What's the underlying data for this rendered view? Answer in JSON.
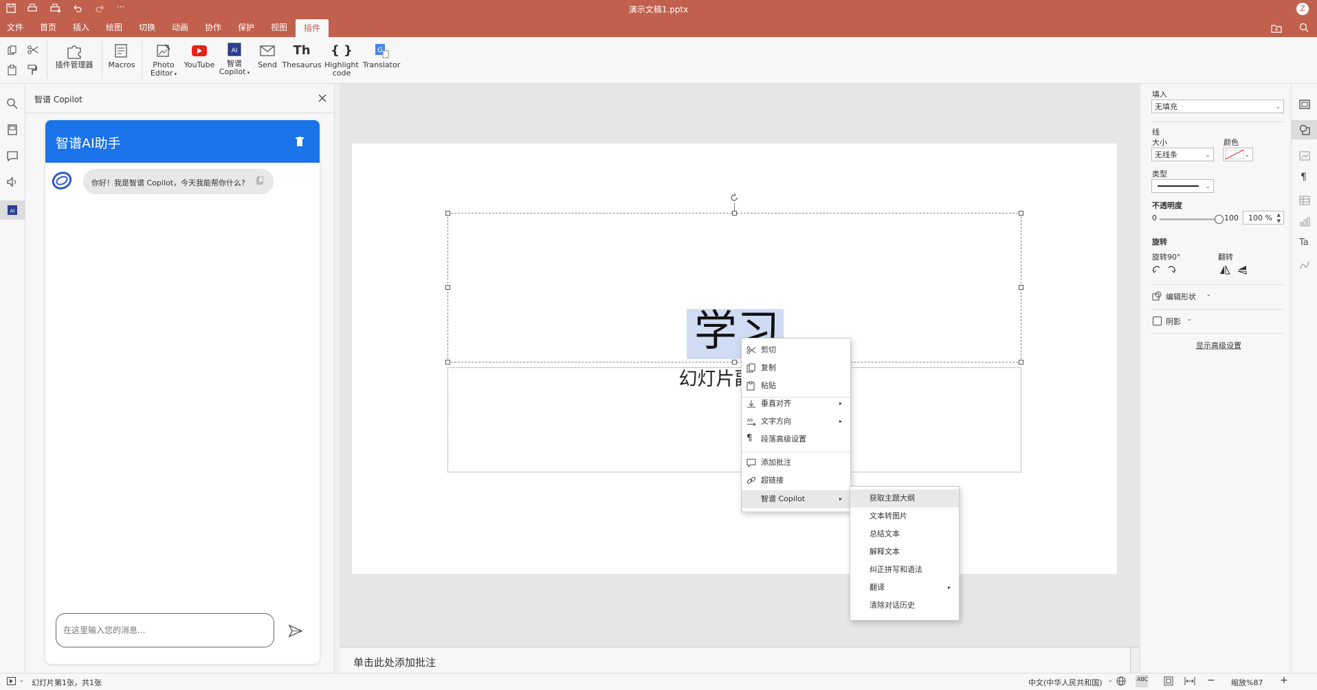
{
  "window": {
    "title": "演示文稿1.pptx",
    "user_initial": "Z"
  },
  "menu": {
    "items": [
      "文件",
      "首页",
      "插入",
      "绘图",
      "切换",
      "动画",
      "协作",
      "保护",
      "视图",
      "插件"
    ],
    "active": "插件"
  },
  "toolbar": {
    "plugin_manager": "插件管理器",
    "macros": "Macros",
    "photo_editor": [
      "Photo",
      "Editor"
    ],
    "youtube": "YouTube",
    "copilot": [
      "智谱",
      "Copilot"
    ],
    "send": "Send",
    "thesaurus": "Thesaurus",
    "thesaurus_glyph": "Th",
    "highlight": [
      "Highlight",
      "code"
    ],
    "highlight_glyph": "{ }",
    "translator": "Translator"
  },
  "copilot_panel": {
    "title": "智谱 Copilot",
    "card_title": "智谱AI助手",
    "greeting": "你好！我是智谱 Copilot，今天我能帮你什么?",
    "input_placeholder": "在这里输入您的消息..."
  },
  "slide": {
    "title_text": "学习",
    "subtitle_text": "幻灯片副标题"
  },
  "context_menu": {
    "items": [
      "剪切",
      "复制",
      "粘贴",
      "垂直对齐",
      "文字方向",
      "段落高级设置",
      "添加批注",
      "超链接",
      "智谱 Copilot"
    ]
  },
  "copilot_submenu": {
    "items": [
      "获取主题大纲",
      "文本转图片",
      "总结文本",
      "解释文本",
      "纠正拼写和语法",
      "翻译",
      "清除对话历史"
    ]
  },
  "notes": {
    "placeholder": "单击此处添加批注"
  },
  "right_panel": {
    "fill_label": "填入",
    "fill_value": "无填充",
    "line_label": "线",
    "size_label": "大小",
    "size_value": "无线条",
    "color_label": "颜色",
    "type_label": "类型",
    "opacity_label": "不透明度",
    "opacity_min": "0",
    "opacity_max": "100",
    "opacity_value": "100 %",
    "rotation_label": "旋转",
    "rotate90_label": "旋转90°",
    "flip_label": "翻转",
    "edit_shape": "编辑形状",
    "shadow": "阴影",
    "advanced": "显示高级设置"
  },
  "status": {
    "slide_info": "幻灯片第1张，共1张",
    "language": "中文(中华人民共和国)",
    "zoom": "缩放%87"
  },
  "colors": {
    "brand": "#c0604d",
    "copilot_blue": "#1a73e8"
  }
}
